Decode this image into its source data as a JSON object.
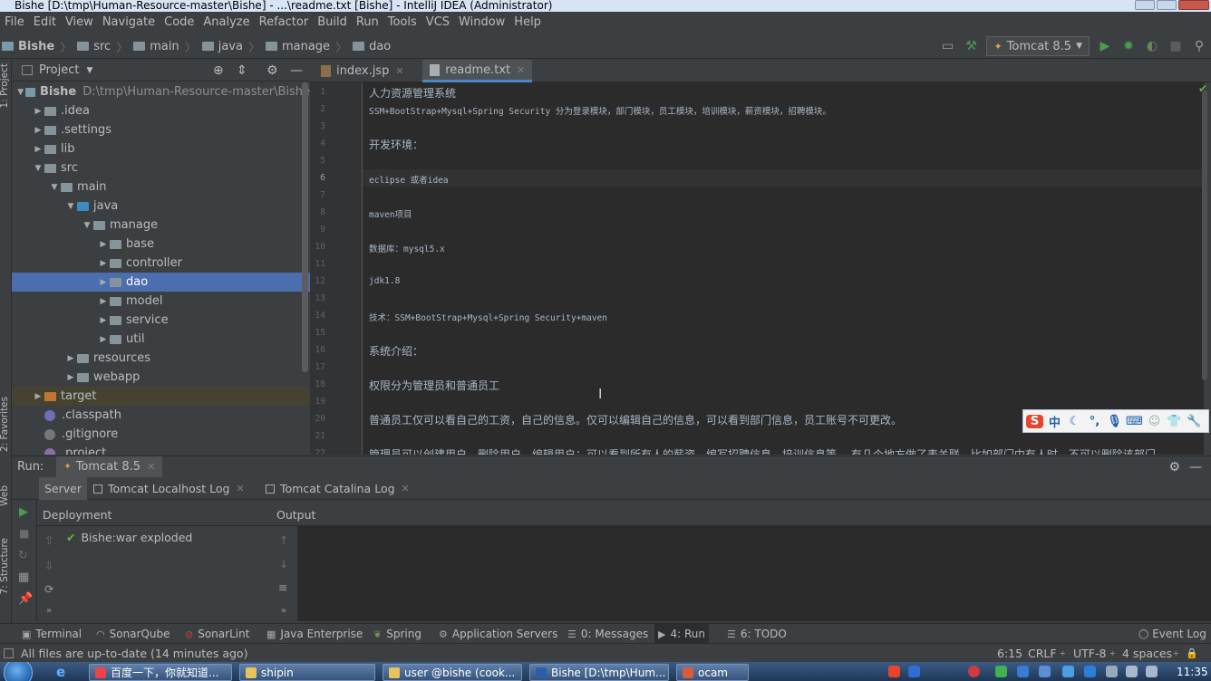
{
  "window": {
    "title": "Bishe [D:\\tmp\\Human-Resource-master\\Bishe] - ...\\readme.txt [Bishe] - IntelliJ IDEA (Administrator)"
  },
  "menu": [
    "File",
    "Edit",
    "View",
    "Navigate",
    "Code",
    "Analyze",
    "Refactor",
    "Build",
    "Run",
    "Tools",
    "VCS",
    "Window",
    "Help"
  ],
  "breadcrumb": [
    "Bishe",
    "src",
    "main",
    "java",
    "manage",
    "dao"
  ],
  "run_config": "Tomcat 8.5",
  "project_panel": {
    "title": "Project",
    "tree": [
      {
        "label": "Bishe",
        "path": "D:\\tmp\\Human-Resource-master\\Bishe",
        "depth": 0,
        "expanded": true,
        "kind": "module"
      },
      {
        "label": ".idea",
        "depth": 1,
        "expanded": false,
        "kind": "folder"
      },
      {
        "label": ".settings",
        "depth": 1,
        "expanded": false,
        "kind": "folder"
      },
      {
        "label": "lib",
        "depth": 1,
        "expanded": false,
        "kind": "folder"
      },
      {
        "label": "src",
        "depth": 1,
        "expanded": true,
        "kind": "folder"
      },
      {
        "label": "main",
        "depth": 2,
        "expanded": true,
        "kind": "folder"
      },
      {
        "label": "java",
        "depth": 3,
        "expanded": true,
        "kind": "source"
      },
      {
        "label": "manage",
        "depth": 4,
        "expanded": true,
        "kind": "package"
      },
      {
        "label": "base",
        "depth": 5,
        "expanded": false,
        "kind": "package"
      },
      {
        "label": "controller",
        "depth": 5,
        "expanded": false,
        "kind": "package"
      },
      {
        "label": "dao",
        "depth": 5,
        "expanded": false,
        "kind": "package",
        "selected": true
      },
      {
        "label": "model",
        "depth": 5,
        "expanded": false,
        "kind": "package"
      },
      {
        "label": "service",
        "depth": 5,
        "expanded": false,
        "kind": "package"
      },
      {
        "label": "util",
        "depth": 5,
        "expanded": false,
        "kind": "package"
      },
      {
        "label": "resources",
        "depth": 3,
        "expanded": false,
        "kind": "resources"
      },
      {
        "label": "webapp",
        "depth": 3,
        "expanded": false,
        "kind": "web"
      },
      {
        "label": "target",
        "depth": 1,
        "expanded": false,
        "kind": "excluded"
      },
      {
        "label": ".classpath",
        "depth": 1,
        "kind": "file"
      },
      {
        "label": ".gitignore",
        "depth": 1,
        "kind": "file"
      },
      {
        "label": ".project",
        "depth": 1,
        "kind": "file"
      }
    ]
  },
  "editor_tabs": [
    {
      "label": "index.jsp",
      "active": false
    },
    {
      "label": "readme.txt",
      "active": true
    }
  ],
  "editor": {
    "lines": [
      {
        "n": "1",
        "text": "人力资源管理系统"
      },
      {
        "n": "2",
        "text": "SSM+BootStrap+Mysql+Spring Security 分为登录模块，部门模块，员工模块，培训模块，薪资模块，招聘模块。"
      },
      {
        "n": "3",
        "text": ""
      },
      {
        "n": "4",
        "text": "开发环境："
      },
      {
        "n": "5",
        "text": ""
      },
      {
        "n": "6",
        "text": "eclipse 或者idea"
      },
      {
        "n": "7",
        "text": ""
      },
      {
        "n": "8",
        "text": " maven项目"
      },
      {
        "n": "9",
        "text": ""
      },
      {
        "n": "10",
        "text": " 数据库：mysql5.x"
      },
      {
        "n": "11",
        "text": ""
      },
      {
        "n": "12",
        "text": " jdk1.8"
      },
      {
        "n": "13",
        "text": ""
      },
      {
        "n": "14",
        "text": " 技术：SSM+BootStrap+Mysql+Spring Security+maven"
      },
      {
        "n": "15",
        "text": ""
      },
      {
        "n": "16",
        "text": "系统介绍："
      },
      {
        "n": "17",
        "text": ""
      },
      {
        "n": "18",
        "text": "权限分为管理员和普通员工"
      },
      {
        "n": "19",
        "text": ""
      },
      {
        "n": "20",
        "text": "普通员工仅可以看自己的工资，自己的信息。仅可以编辑自己的信息，可以看到部门信息，员工账号不可更改。"
      },
      {
        "n": "21",
        "text": ""
      },
      {
        "n": "22",
        "text": "管理员可以创建用户，删除用户，编辑用户；可以看到所有人的薪资，编写招聘信息，培训信息等。 有几个地方做了表关联，比如部门中有人时，不可以删除该部门"
      }
    ],
    "current_line": 6
  },
  "run_panel": {
    "label": "Run:",
    "config_tab": "Tomcat 8.5",
    "tabs": [
      "Server",
      "Tomcat Localhost Log",
      "Tomcat Catalina Log"
    ],
    "deployment_header": "Deployment",
    "output_header": "Output",
    "deployments": [
      "Bishe:war exploded"
    ]
  },
  "tool_windows": [
    {
      "label": "Terminal"
    },
    {
      "label": "SonarQube"
    },
    {
      "label": "SonarLint"
    },
    {
      "label": "Java Enterprise"
    },
    {
      "label": "Spring"
    },
    {
      "label": "Application Servers"
    },
    {
      "label": "0: Messages"
    },
    {
      "label": "4: Run",
      "active": true
    },
    {
      "label": "6: TODO"
    }
  ],
  "event_log": "Event Log",
  "side_tabs": {
    "project": "1: Project",
    "favorites": "2: Favorites",
    "web": "Web",
    "structure": "7: Structure"
  },
  "status": {
    "message": "All files are up-to-date (14 minutes ago)",
    "position": "6:15",
    "line_sep": "CRLF",
    "encoding": "UTF-8",
    "indent": "4 spaces"
  },
  "taskbar": {
    "items": [
      "百度一下，你就知道...",
      "shipin",
      "user @bishe (cook...",
      "Bishe [D:\\tmp\\Hum...",
      "ocam"
    ],
    "clock": "11:35"
  },
  "ime": {
    "lang": "中"
  }
}
